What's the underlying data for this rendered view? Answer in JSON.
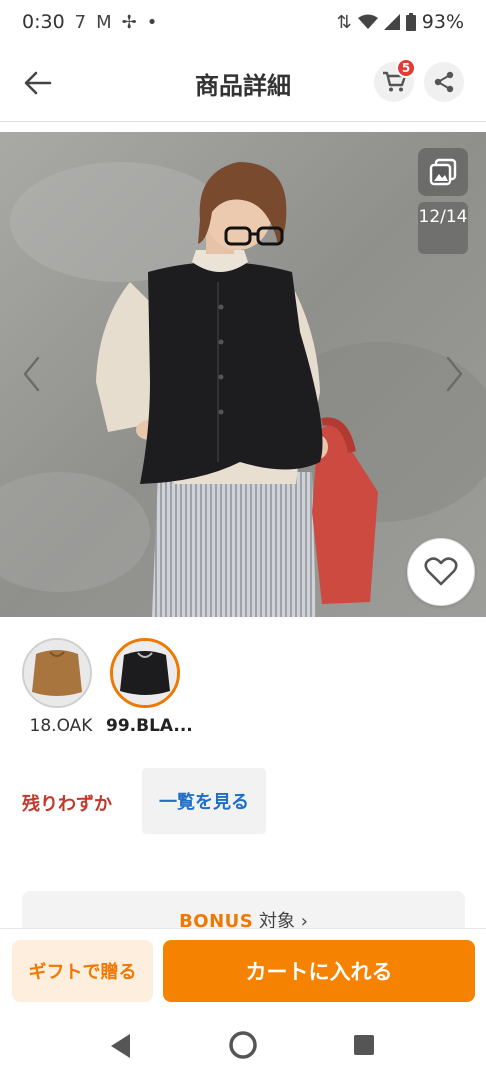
{
  "status_bar": {
    "time": "0:30",
    "icons": [
      "notification-7-icon",
      "gmail-icon",
      "pinwheel-icon",
      "dot-icon"
    ],
    "right_icons": [
      "data-arrows-icon",
      "wifi-icon",
      "signal-icon",
      "battery-icon"
    ],
    "battery": "93%"
  },
  "header": {
    "title": "商品詳細",
    "cart_count": "5"
  },
  "hero": {
    "counter": "12/14"
  },
  "swatches": [
    {
      "label": "18.OAK",
      "selected": false
    },
    {
      "label": "99.BLA...",
      "selected": true
    }
  ],
  "stock": {
    "status": "残りわずか",
    "list_button": "一覧を見る"
  },
  "bonus": {
    "word": "BONUS",
    "suffix": "対象",
    "chevron": "›"
  },
  "actions": {
    "gift": "ギフトで贈る",
    "add_to_cart": "カートに入れる"
  },
  "colors": {
    "accent": "#f58200",
    "badge": "#e53935",
    "stock_red": "#c0392b",
    "link_blue": "#1e6fc8"
  }
}
